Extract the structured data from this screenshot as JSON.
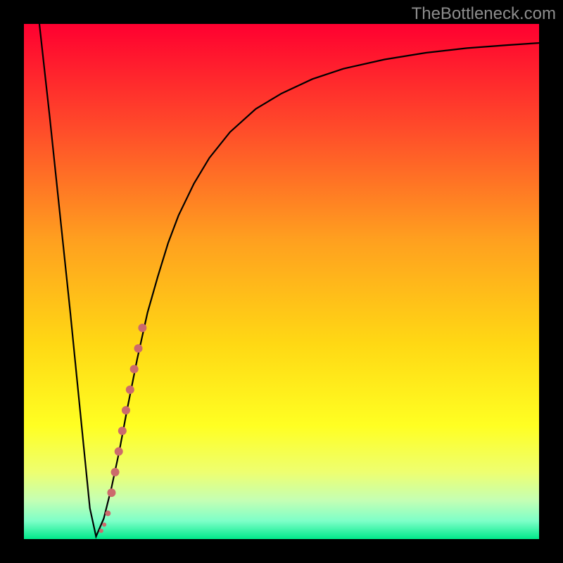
{
  "watermark": "TheBottleneck.com",
  "colors": {
    "curve_stroke": "#000000",
    "marker_fill": "#cc6a6c",
    "gradient_stops": [
      {
        "offset": 0.0,
        "color": "#ff0030"
      },
      {
        "offset": 0.2,
        "color": "#ff4a2a"
      },
      {
        "offset": 0.42,
        "color": "#ffa01f"
      },
      {
        "offset": 0.62,
        "color": "#ffd814"
      },
      {
        "offset": 0.78,
        "color": "#ffff22"
      },
      {
        "offset": 0.87,
        "color": "#eeff70"
      },
      {
        "offset": 0.925,
        "color": "#c4ffb4"
      },
      {
        "offset": 0.965,
        "color": "#7dffc8"
      },
      {
        "offset": 1.0,
        "color": "#00e88a"
      }
    ]
  },
  "chart_data": {
    "type": "line",
    "title": "",
    "xlabel": "",
    "ylabel": "",
    "xlim": [
      0,
      100
    ],
    "ylim": [
      0,
      100
    ],
    "series": [
      {
        "name": "bottleneck-curve",
        "x": [
          3,
          5,
          7,
          9,
          11,
          12.8,
          14,
          15.5,
          17,
          18.5,
          20,
          22,
          24,
          26,
          28,
          30,
          33,
          36,
          40,
          45,
          50,
          56,
          62,
          70,
          78,
          86,
          94,
          100
        ],
        "y": [
          100,
          82,
          63,
          44,
          24,
          6,
          0.5,
          4,
          10,
          17,
          25,
          35,
          44,
          51,
          57.5,
          62.8,
          69,
          74,
          79,
          83.5,
          86.5,
          89.3,
          91.3,
          93.1,
          94.4,
          95.3,
          95.9,
          96.3
        ]
      }
    ],
    "markers": {
      "name": "highlighted-range",
      "comment": "thick salmon segment riding the curve near the bottom-right of the dip, with a couple of small dots at the very bottom",
      "points": [
        {
          "x": 15.0,
          "y": 1.6,
          "r": 3
        },
        {
          "x": 15.6,
          "y": 2.8,
          "r": 3
        },
        {
          "x": 16.3,
          "y": 5.0,
          "r": 4
        },
        {
          "x": 17.0,
          "y": 9.0,
          "r": 6
        },
        {
          "x": 17.7,
          "y": 13.0,
          "r": 6
        },
        {
          "x": 18.4,
          "y": 17.0,
          "r": 6
        },
        {
          "x": 19.1,
          "y": 21.0,
          "r": 6
        },
        {
          "x": 19.8,
          "y": 25.0,
          "r": 6
        },
        {
          "x": 20.6,
          "y": 29.0,
          "r": 6
        },
        {
          "x": 21.4,
          "y": 33.0,
          "r": 6
        },
        {
          "x": 22.2,
          "y": 37.0,
          "r": 6
        },
        {
          "x": 23.0,
          "y": 41.0,
          "r": 6
        }
      ]
    }
  }
}
